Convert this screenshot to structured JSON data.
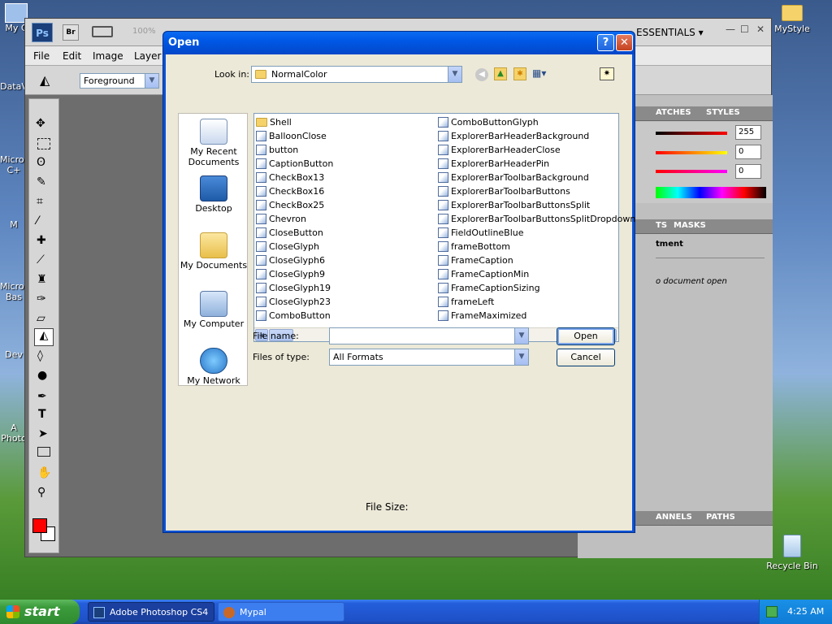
{
  "desktop": {
    "icons_left": [
      "My C",
      "DataV",
      "Micros C+",
      "M",
      "Micros Bas",
      "Dev",
      "A Photo"
    ],
    "mystyle_label": "MyStyle",
    "recycle_label": "Recycle Bin"
  },
  "photoshop": {
    "zoom": "100%",
    "workspace": "ESSENTIALS",
    "menu": [
      "File",
      "Edit",
      "Image",
      "Layer"
    ],
    "fill_source": "Foreground",
    "panels": {
      "tab1": "ATCHES",
      "tab2": "STYLES",
      "tab3": "TS",
      "tab4": "MASKS",
      "tab5": "ANNELS",
      "tab6": "PATHS",
      "rgb": [
        "255",
        "0",
        "0"
      ],
      "adjust_label": "tment",
      "no_doc": "o document open"
    }
  },
  "dialog": {
    "title": "Open",
    "look_in_label": "Look in:",
    "look_in_value": "NormalColor",
    "places": [
      "My Recent Documents",
      "Desktop",
      "My Documents",
      "My Computer",
      "My Network"
    ],
    "files_col1": [
      "Shell",
      "BalloonClose",
      "button",
      "CaptionButton",
      "CheckBox13",
      "CheckBox16",
      "CheckBox25",
      "Chevron",
      "CloseButton",
      "CloseGlyph",
      "CloseGlyph6",
      "CloseGlyph9",
      "CloseGlyph19",
      "CloseGlyph23",
      "ComboButton"
    ],
    "files_col2": [
      "ComboButtonGlyph",
      "ExplorerBarHeaderBackground",
      "ExplorerBarHeaderClose",
      "ExplorerBarHeaderPin",
      "ExplorerBarToolbarBackground",
      "ExplorerBarToolbarButtons",
      "ExplorerBarToolbarButtonsSplit",
      "ExplorerBarToolbarButtonsSplitDropdown",
      "FieldOutlineBlue",
      "frameBottom",
      "FrameCaption",
      "FrameCaptionMin",
      "FrameCaptionSizing",
      "frameLeft",
      "FrameMaximized"
    ],
    "file_name_label": "File name:",
    "file_name_value": "",
    "file_type_label": "Files of type:",
    "file_type_value": "All Formats",
    "open_button": "Open",
    "cancel_button": "Cancel",
    "file_size_label": "File Size:"
  },
  "taskbar": {
    "start": "start",
    "tasks": [
      "Adobe Photoshop CS4",
      "Mypal"
    ],
    "clock": "4:25 AM"
  }
}
